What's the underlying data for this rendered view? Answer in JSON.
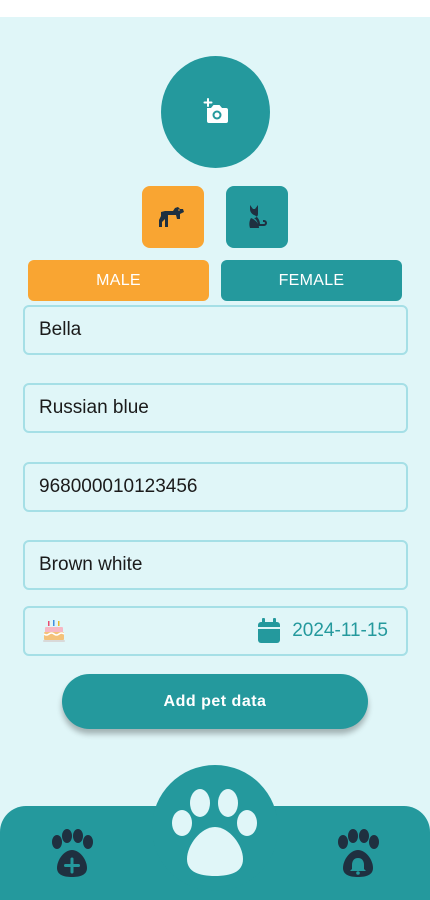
{
  "colors": {
    "teal": "#24999d",
    "orange": "#f9a532",
    "background": "#e0f6f8",
    "field_border": "#a5dfe6",
    "icon_dark": "#1f3040",
    "paw_light": "#e0f6f8"
  },
  "header": {
    "photo_icon": "add-photo-icon"
  },
  "species": {
    "dog_icon": "dog-icon",
    "cat_icon": "cat-icon",
    "selected": "dog"
  },
  "gender": {
    "male_label": "MALE",
    "female_label": "FEMALE",
    "selected": "male"
  },
  "form": {
    "name": "Bella",
    "breed": "Russian blue",
    "chip_number": "968000010123456",
    "color": "Brown white",
    "birthday": "2024-11-15",
    "birthday_icon": "birthday-cake-icon",
    "calendar_icon": "calendar-icon"
  },
  "actions": {
    "submit_label": "Add pet data"
  },
  "bottom_nav": {
    "left_icon": "paw-plus-icon",
    "center_icon": "paw-icon",
    "right_icon": "paw-bell-icon"
  }
}
